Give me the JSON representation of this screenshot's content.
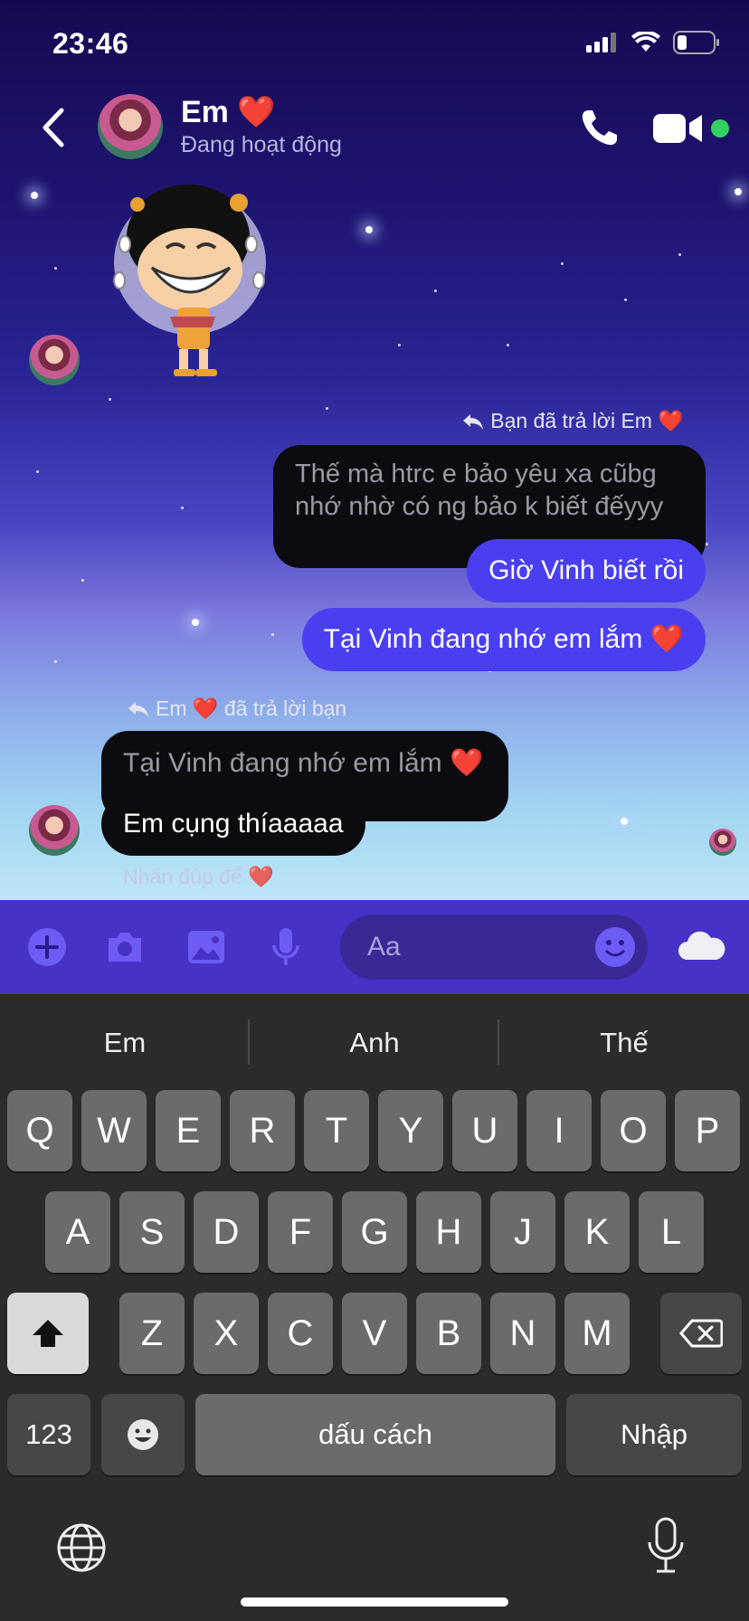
{
  "status_bar": {
    "time": "23:46"
  },
  "header": {
    "contact_name": "Em ❤️",
    "contact_status": "Đang hoạt động"
  },
  "messages": {
    "outgoing_reply_note": "Bạn đã trả lời Em ❤️",
    "outgoing_quoted_text": "Thế mà htrc e bảo yêu xa cũbg\nnhớ nhờ có ng bảo k biết đếyyy",
    "outgoing_1": "Giờ Vinh biết rồi",
    "outgoing_2": "Tại Vinh đang nhớ em lắm ❤️",
    "incoming_reply_note": "Em ❤️ đã trả lời bạn",
    "incoming_quoted_text": "Tại Vinh đang nhớ em lắm ❤️",
    "incoming_1": "Em cụng thíaaaaa",
    "nickname_hint": "Nhấn đúp để ❤️"
  },
  "composer": {
    "placeholder": "Aa"
  },
  "keyboard": {
    "suggestions": [
      "Em",
      "Anh",
      "Thế"
    ],
    "row1": [
      "Q",
      "W",
      "E",
      "R",
      "T",
      "Y",
      "U",
      "I",
      "O",
      "P"
    ],
    "row2": [
      "A",
      "S",
      "D",
      "F",
      "G",
      "H",
      "J",
      "K",
      "L"
    ],
    "row3": [
      "Z",
      "X",
      "C",
      "V",
      "B",
      "N",
      "M"
    ],
    "numbers_key": "123",
    "space_key": "dấu cách",
    "return_key": "Nhập"
  },
  "colors": {
    "accent": "#4a3ff0",
    "composer_bg": "#4732c8",
    "active_dot": "#31d15f"
  }
}
